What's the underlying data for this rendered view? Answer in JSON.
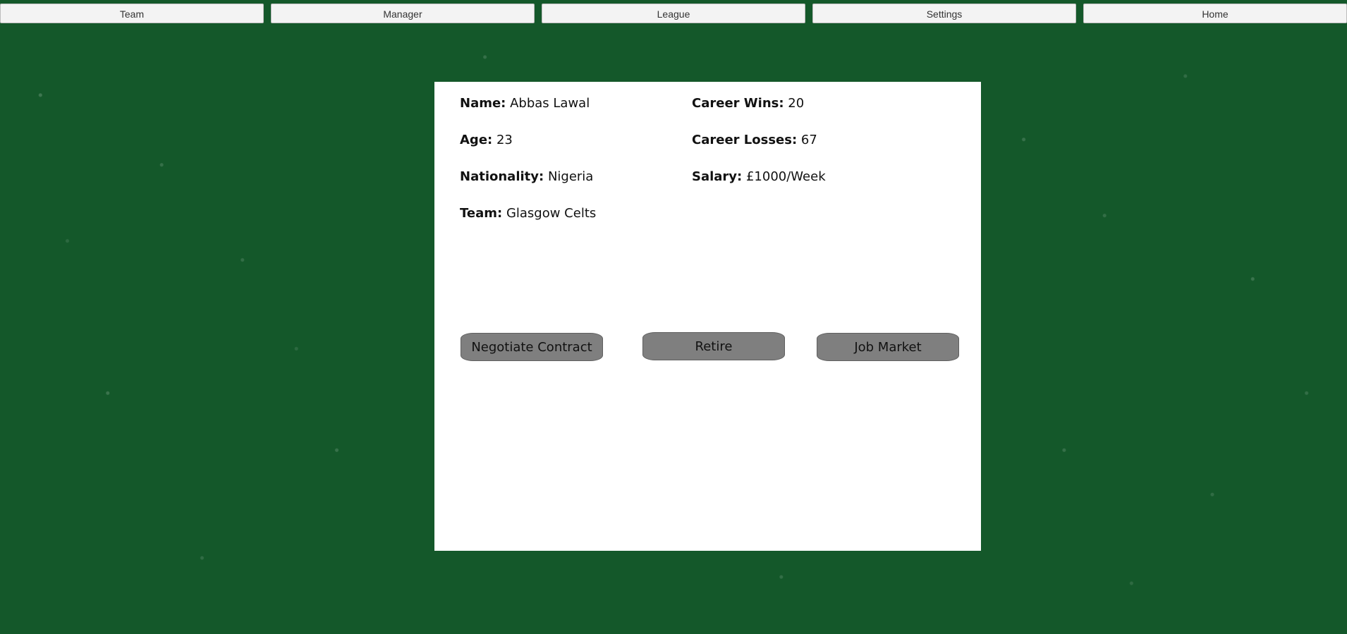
{
  "nav": {
    "items": [
      {
        "label": "Team"
      },
      {
        "label": "Manager"
      },
      {
        "label": "League"
      },
      {
        "label": "Settings"
      },
      {
        "label": "Home"
      }
    ]
  },
  "profile": {
    "name_label": "Name:",
    "name_value": "Abbas Lawal",
    "age_label": "Age:",
    "age_value": "23",
    "nationality_label": "Nationality:",
    "nationality_value": "Nigeria",
    "team_label": "Team:",
    "team_value": "Glasgow Celts",
    "career_wins_label": "Career Wins:",
    "career_wins_value": "20",
    "career_losses_label": "Career Losses:",
    "career_losses_value": "67",
    "salary_label": "Salary:",
    "salary_value": " £1000/Week"
  },
  "actions": {
    "negotiate_label": "Negotiate Contract",
    "retire_label": "Retire",
    "job_market_label": "Job Market"
  },
  "colors": {
    "background": "#14582a",
    "card": "#ffffff",
    "nav_button": "#f3f3f3",
    "action_button": "#7f7f7f"
  }
}
